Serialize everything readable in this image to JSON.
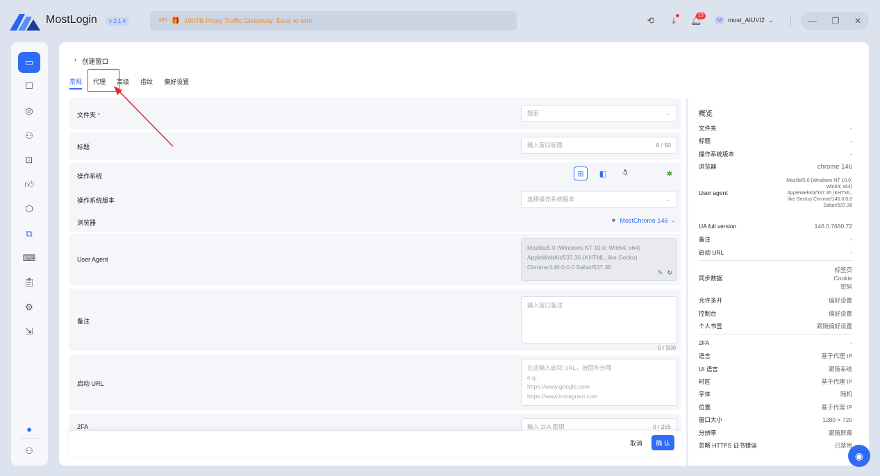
{
  "titlebar": {
    "app_name": "MostLogin",
    "version": "v 2.1.4",
    "promo_text": "100TB Proxy Traffic Giveaway: Easy to win!",
    "notification_count": "13",
    "username": "most_AIUVI2",
    "avatar_letter": "M"
  },
  "page": {
    "back_title": "创建窗口",
    "tabs": [
      "常规",
      "代理",
      "高级",
      "指纹",
      "偏好设置"
    ]
  },
  "form": {
    "folder": {
      "label": "文件夹",
      "placeholder": "搜索"
    },
    "title": {
      "label": "标题",
      "placeholder": "输入窗口标题",
      "count": "0 / 50"
    },
    "os": {
      "label": "操作系统"
    },
    "os_version": {
      "label": "操作系统版本",
      "placeholder": "选择操作系统版本"
    },
    "browser": {
      "label": "浏览器",
      "value": "MostChrome 146"
    },
    "user_agent": {
      "label": "User Agent",
      "lines": [
        "Mozilla/5.0 (Windows NT 10.0; Win64; x64)",
        "AppleWebKit/537.36 (KHTML, like Gecko)",
        "Chrome/146.0.0.0 Safari/537.36"
      ]
    },
    "notes": {
      "label": "备注",
      "placeholder": "输入窗口备注",
      "count": "0 / 500"
    },
    "startup_url": {
      "label": "启动 URL",
      "lines": [
        "在此输入启动 URL，按回车分隔",
        "e.g.:",
        "https://www.google.com",
        "https://www.instagram.com"
      ]
    },
    "twofa": {
      "label": "2FA",
      "placeholder": "输入 2FA 密钥",
      "count": "0 / 255"
    }
  },
  "footer": {
    "cancel": "取消",
    "confirm": "确 认"
  },
  "overview": {
    "title": "概览",
    "rows": [
      {
        "k": "文件夹",
        "v": "-"
      },
      {
        "k": "标题",
        "v": "-"
      },
      {
        "k": "操作系统版本",
        "v": "-"
      },
      {
        "k": "浏览器",
        "v": "chrome  146"
      },
      {
        "k": "User agent",
        "v": "Mozilla/5.0 (Windows NT 10.0; Win64; x64) AppleWebKit/537.36 (KHTML, like Gecko) Chrome/146.0.0.0 Safari/537.36"
      },
      {
        "k": "UA full version",
        "v": "146.0.7680.72"
      },
      {
        "k": "备注",
        "v": "-"
      },
      {
        "k": "启动 URL",
        "v": "-"
      },
      {
        "k": "同步数据",
        "v1": "标签页",
        "v2": "Cookie",
        "v3": "密码"
      },
      {
        "k": "允许多开",
        "v": "偏好设置"
      },
      {
        "k": "控制台",
        "v": "偏好设置"
      },
      {
        "k": "个人书签",
        "v": "跟随偏好设置"
      },
      {
        "k": "2FA",
        "v": "-"
      },
      {
        "k": "语言",
        "v": "基于代理 IP"
      },
      {
        "k": "UI 语言",
        "v": "跟随系统"
      },
      {
        "k": "时区",
        "v": "基于代理 IP"
      },
      {
        "k": "字体",
        "v": "随机"
      },
      {
        "k": "位置",
        "v": "基于代理 IP"
      },
      {
        "k": "窗口大小",
        "v": "1280 × 720"
      },
      {
        "k": "分辨率",
        "v": "跟随屏幕"
      },
      {
        "k": "忽略 HTTPS 证书错误",
        "v": "已禁用"
      }
    ]
  },
  "colors": {
    "accent": "#2f6cf6",
    "annotation": "#e8282c",
    "promo": "#f08c2a"
  }
}
